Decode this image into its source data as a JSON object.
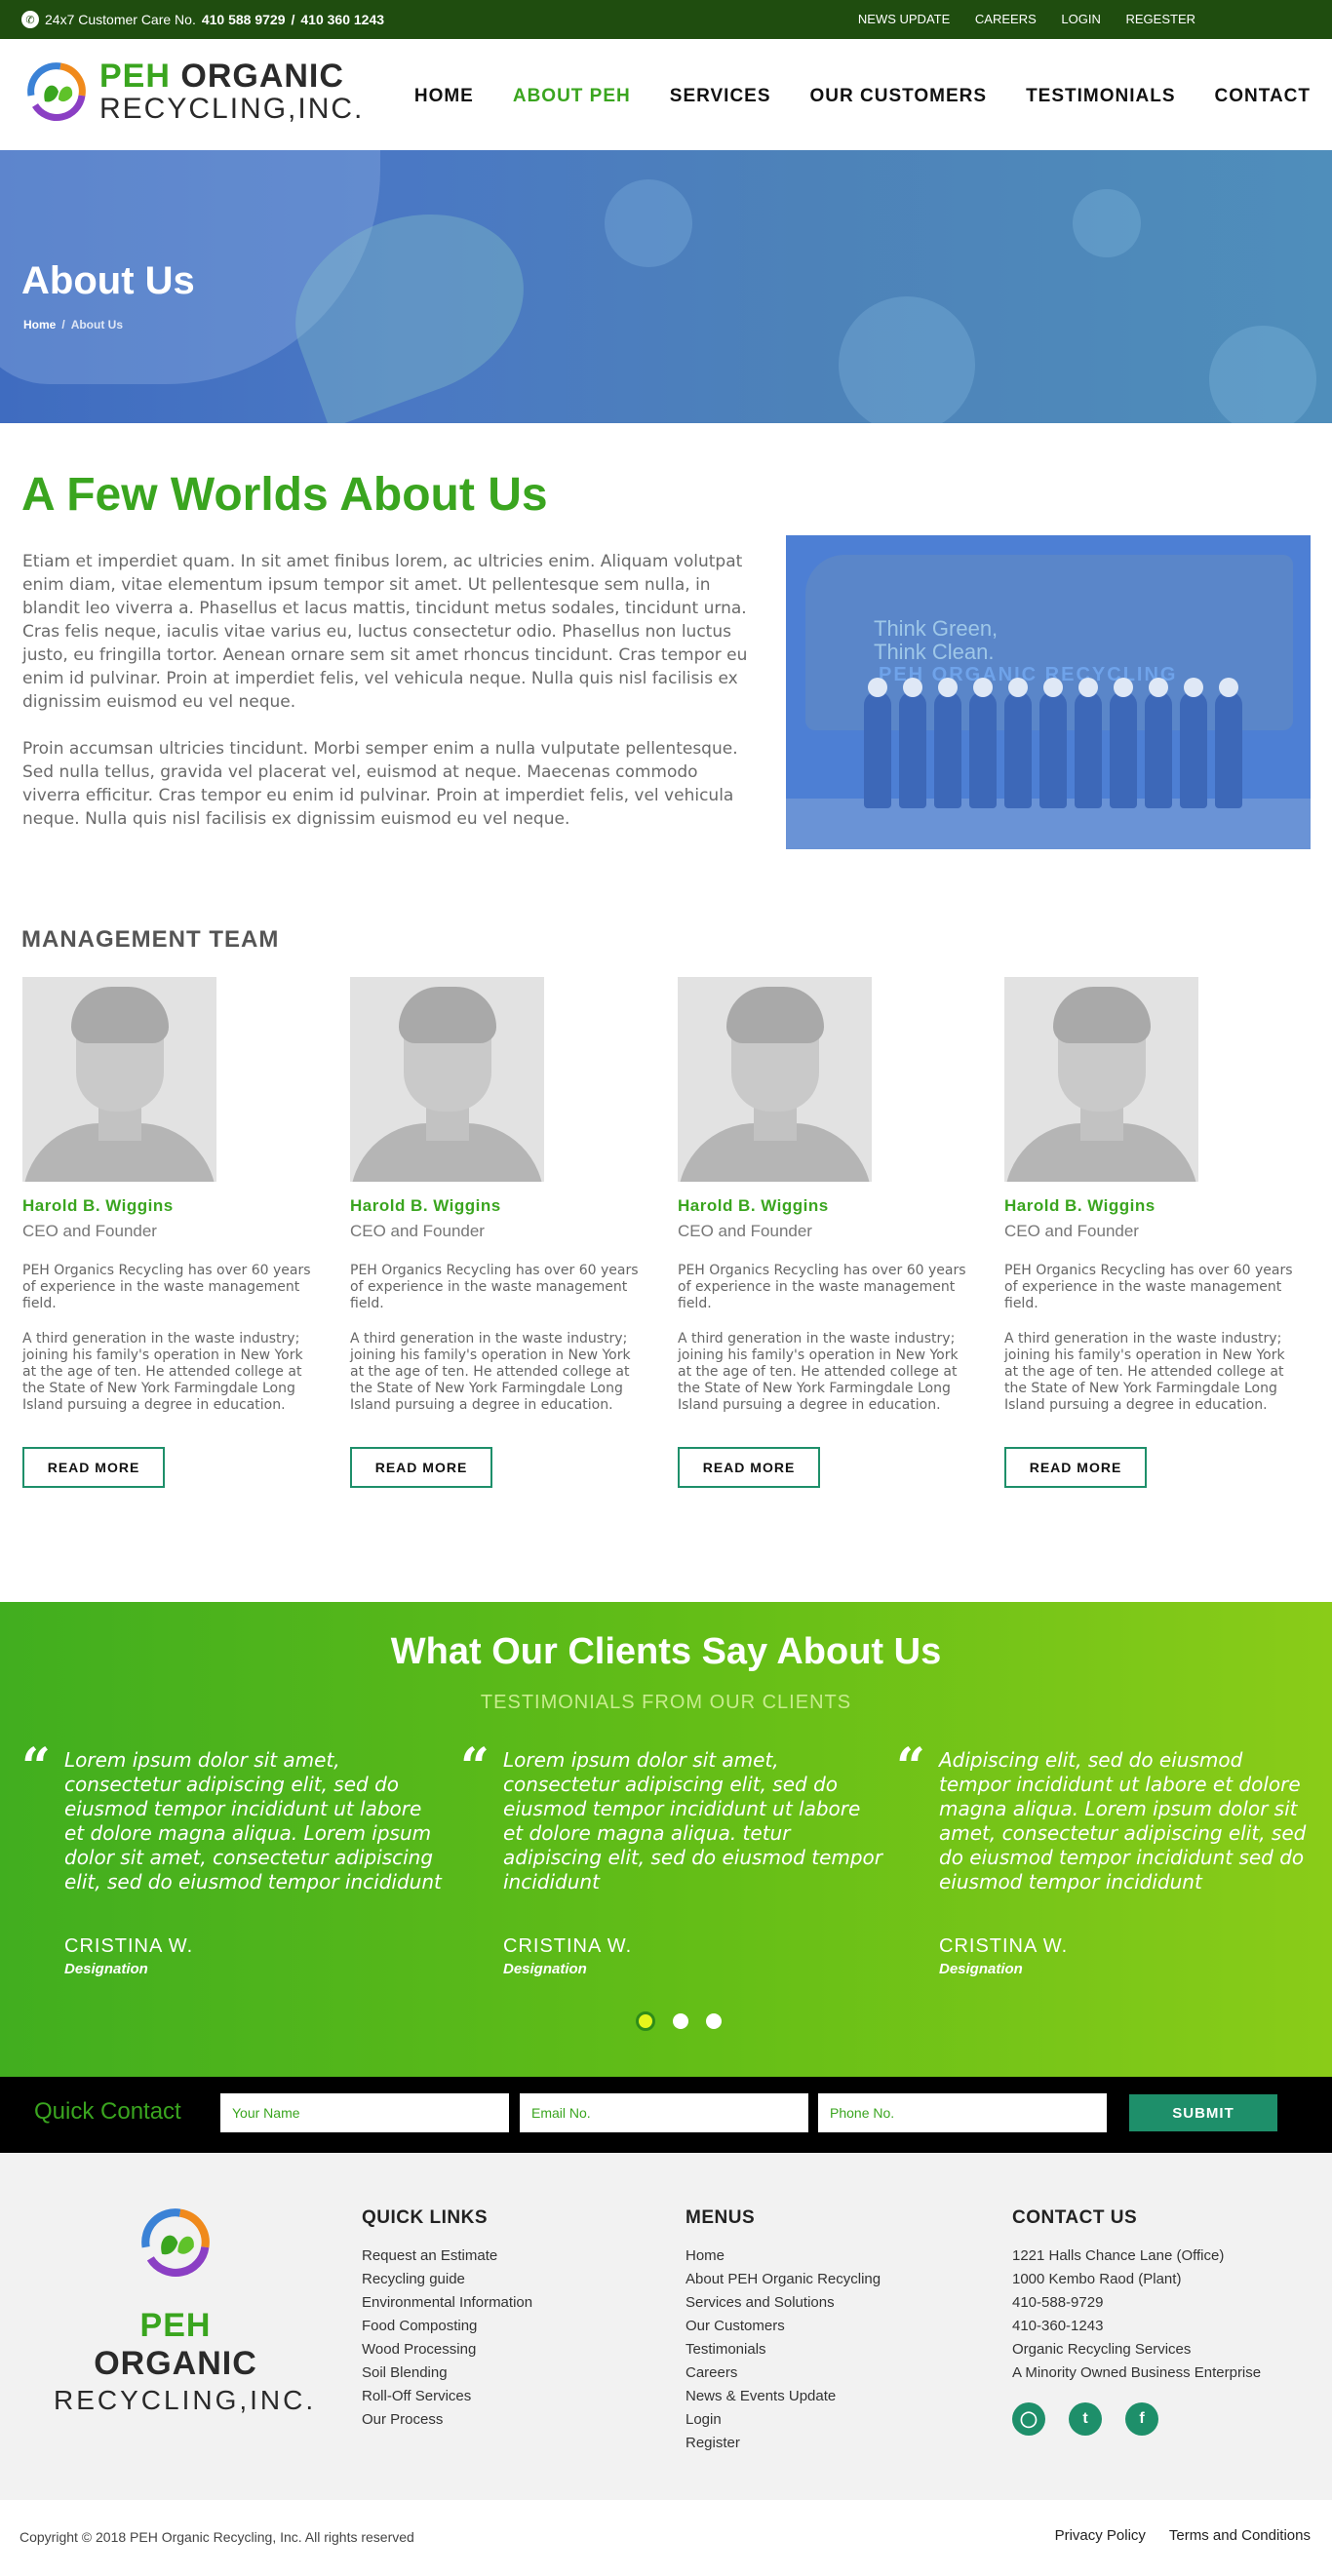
{
  "topbar": {
    "customer_care": "24x7 Customer Care No.",
    "phone1": "410 588 9729",
    "sep": "/",
    "phone2": "410 360 1243",
    "links": [
      "NEWS UPDATE",
      "CAREERS",
      "LOGIN",
      "REGESTER"
    ]
  },
  "logo": {
    "peh": "PEH",
    "organic": "ORGANIC",
    "line2": "RECYCLING,INC."
  },
  "nav": [
    "HOME",
    "ABOUT PEH",
    "SERVICES",
    "OUR CUSTOMERS",
    "TESTIMONIALS",
    "CONTACT"
  ],
  "banner": {
    "title": "About Us",
    "crumb_home": "Home",
    "crumb_sep": "/",
    "crumb_current": "About Us"
  },
  "about": {
    "title": "A Few Worlds About Us",
    "p1": "Etiam et imperdiet quam. In sit amet finibus lorem, ac ultricies enim. Aliquam volutpat enim diam, vitae elementum ipsum tempor sit amet. Ut pellentesque sem nulla, in blandit leo viverra a. Phasellus et lacus mattis, tincidunt metus sodales, tincidunt urna. Cras felis neque, iaculis vitae varius eu, luctus consectetur odio. Phasellus non luctus justo, eu fringilla tortor. Aenean ornare sem sit amet rhoncus tincidunt. Cras tempor eu enim id pulvinar. Proin at imperdiet felis, vel vehicula neque. Nulla quis nisl facilisis ex dignissim euismod eu vel neque.",
    "p2": "Proin accumsan ultricies tincidunt. Morbi semper enim a nulla vulputate pellentesque. Sed nulla tellus, gravida vel placerat vel, euismod at neque. Maecenas commodo viverra efficitur. Cras tempor eu enim id pulvinar. Proin at imperdiet felis, vel vehicula neque. Nulla quis nisl facilisis ex dignissim euismod eu vel neque.",
    "image_text1": "Think Green,",
    "image_text2": "Think Clean.",
    "image_text3": "PEH ORGANIC RECYCLING"
  },
  "management": {
    "title": "MANAGEMENT TEAM",
    "members": [
      {
        "name": "Harold B. Wiggins",
        "role": "CEO and Founder",
        "bio1": "PEH Organics Recycling has over 60 years of experience in the waste management field.",
        "bio2": "A third generation in the waste industry; joining his family's operation in New York at the age of ten. He attended college at the State of New York Farmingdale Long Island pursuing a degree in education.",
        "button": "READ MORE"
      },
      {
        "name": "Harold B. Wiggins",
        "role": "CEO and Founder",
        "bio1": "PEH Organics Recycling has over 60 years of experience in the waste management field.",
        "bio2": "A third generation in the waste industry; joining his family's operation in New York at the age of ten. He attended college at the State of New York Farmingdale Long Island pursuing a degree in education.",
        "button": "READ MORE"
      },
      {
        "name": "Harold B. Wiggins",
        "role": "CEO and Founder",
        "bio1": "PEH Organics Recycling has over 60 years of experience in the waste management field.",
        "bio2": "A third generation in the waste industry; joining his family's operation in New York at the age of ten. He attended college at the State of New York Farmingdale Long Island pursuing a degree in education.",
        "button": "READ MORE"
      },
      {
        "name": "Harold B. Wiggins",
        "role": "CEO and Founder",
        "bio1": "PEH Organics Recycling has over 60 years of experience in the waste management field.",
        "bio2": "A third generation in the waste industry; joining his family's operation in New York at the age of ten. He attended college at the State of New York Farmingdale Long Island pursuing a degree in education.",
        "button": "READ MORE"
      }
    ]
  },
  "testimonials": {
    "title": "What Our Clients Say About Us",
    "subtitle": "TESTIMONIALS FROM OUR CLIENTS",
    "items": [
      {
        "text": "Lorem ipsum dolor sit amet, consectetur adipiscing elit, sed do eiusmod tempor incididunt ut labore et dolore magna aliqua. Lorem ipsum dolor sit amet, consectetur adipiscing elit, sed do eiusmod tempor incididunt",
        "name": "CRISTINA W.",
        "designation": "Designation"
      },
      {
        "text": "Lorem ipsum dolor sit amet, consectetur adipiscing elit, sed do eiusmod tempor incididunt ut labore et dolore magna aliqua. tetur adipiscing elit, sed do eiusmod tempor incididunt",
        "name": "CRISTINA W.",
        "designation": "Designation"
      },
      {
        "text": "Adipiscing elit, sed do eiusmod tempor incididunt ut labore et dolore magna aliqua. Lorem ipsum dolor sit amet, consectetur adipiscing elit, sed do eiusmod tempor incididunt sed do eiusmod tempor incididunt",
        "name": "CRISTINA W.",
        "designation": "Designation"
      }
    ],
    "active_dot": 1
  },
  "quick_contact": {
    "label": "Quick Contact",
    "name_placeholder": "Your Name",
    "email_placeholder": "Email No.",
    "phone_placeholder": "Phone No.",
    "submit": "SUBMIT"
  },
  "footer": {
    "quick_links_title": "QUICK LINKS",
    "quick_links": [
      "Request an Estimate",
      "Recycling guide",
      "Environmental Information",
      "Food Composting",
      "Wood Processing",
      "Soil Blending",
      "Roll-Off Services",
      "Our Process"
    ],
    "menus_title": "MENUS",
    "menus": [
      "Home",
      "About PEH Organic Recycling",
      "Services and Solutions",
      "Our Customers",
      "Testimonials",
      "Careers",
      "News & Events Update",
      "Login",
      "Register"
    ],
    "contact_title": "CONTACT US",
    "contact": [
      "1221 Halls Chance Lane (Office)",
      "1000 Kembo Raod (Plant)",
      "410-588-9729",
      "410-360-1243",
      "Organic Recycling Services",
      "A Minority Owned Business Enterprise"
    ],
    "social": [
      "instagram-icon",
      "twitter-icon",
      "facebook-icon"
    ]
  },
  "bottom": {
    "copyright": "Copyright © 2018  PEH Organic Recycling, Inc.    All rights reserved",
    "links": [
      "Privacy Policy",
      "Terms and Conditions"
    ]
  },
  "colors": {
    "brand_green": "#3aa51f",
    "dark_green": "#1f4d0f",
    "teal": "#1e8f6a"
  }
}
